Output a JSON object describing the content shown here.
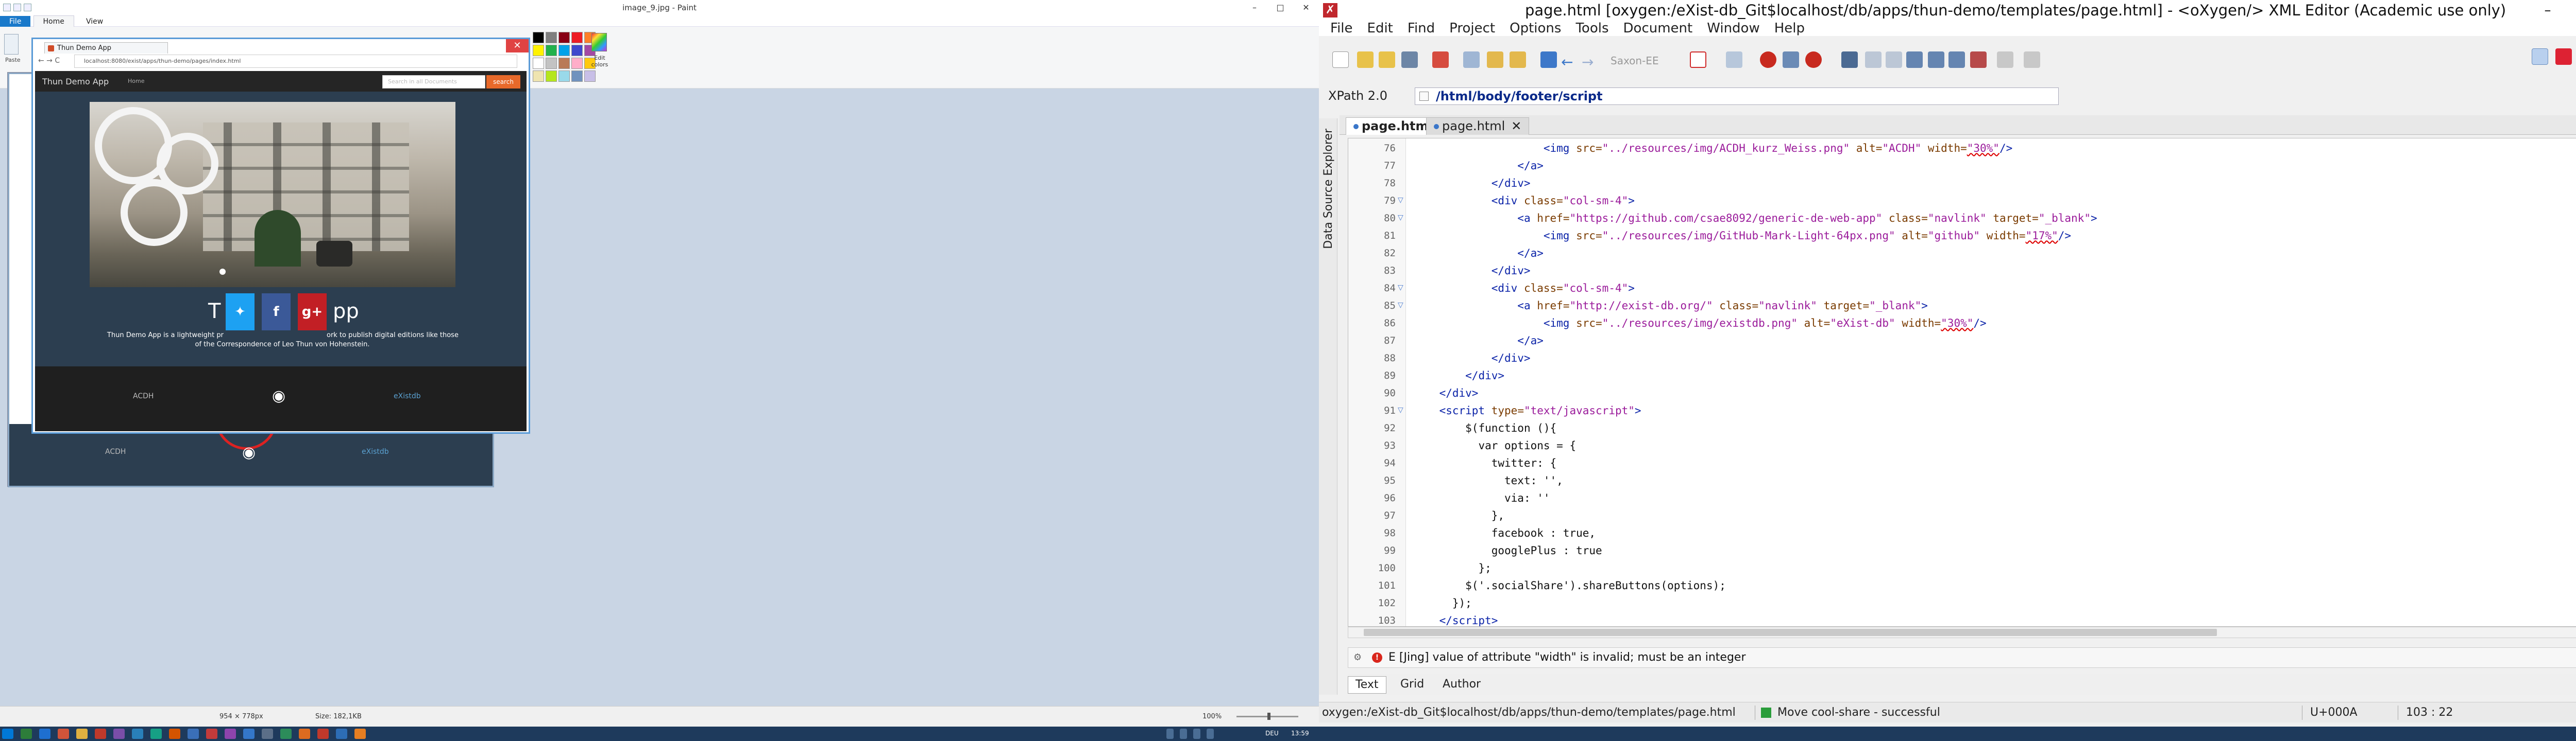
{
  "paint": {
    "title": "image_9.jpg - Paint",
    "tabs": [
      "File",
      "Home",
      "View"
    ],
    "paste_label": "Paste",
    "edit_colors": "Edit colors",
    "palette": [
      "#000000",
      "#7f7f7f",
      "#880015",
      "#ed1c24",
      "#ff7f27",
      "#fff200",
      "#22b14c",
      "#00a2e8",
      "#3f48cc",
      "#a349a4",
      "#ffffff",
      "#c3c3c3",
      "#b97a57",
      "#ffaec9",
      "#ffc90e",
      "#efe4b0",
      "#b5e61d",
      "#99d9ea",
      "#7092be",
      "#c8bfe7"
    ],
    "status": {
      "dimensions": "954 × 778px",
      "size": "Size: 182,1KB",
      "zoom": "100%"
    }
  },
  "browser": {
    "tab_title": "Thun Demo App",
    "address": "localhost:8080/exist/apps/thun-demo/pages/index.html",
    "site": {
      "brand": "Thun Demo App",
      "nav_home": "Home",
      "search_placeholder": "Search in all Documents",
      "search_button": "search",
      "heading": "Thun Demo App",
      "heading_visible": "pp",
      "heading_partial": "T",
      "description": "Thun Demo App is a lightweight project to publish digital editions like those of the Correspondence of Leo Thun von Hohenstein.",
      "desc_line1": "Thun Demo App is a lightweight pr",
      "desc_line1b": "ork to publish digital editions like those",
      "desc_line2": "of the Correspondence of Leo Thun von Hohenstein.",
      "share": [
        "twitter",
        "f",
        "g+"
      ],
      "footer": [
        "ACDH",
        "github",
        "eXistdb"
      ]
    }
  },
  "oxygen": {
    "title": "page.html [oxygen:/eXist-db_Git$localhost/db/apps/thun-demo/templates/page.html] - <oXygen/> XML Editor (Academic use only)",
    "menu": [
      "File",
      "Edit",
      "Find",
      "Project",
      "Options",
      "Tools",
      "Document",
      "Window",
      "Help"
    ],
    "saxon": "Saxon-EE",
    "xpath_label": "XPath 2.0",
    "xpath_value": "/html/body/footer/script",
    "side_panel": "Data Source Explorer",
    "tabs": [
      "page.html",
      "page.html"
    ],
    "lines": [
      {
        "n": "76",
        "html": "                    <span class='tg'>&lt;img</span> <span class='at'>src=</span><span class='vl'>\"../resources/img/ACDH_kurz_Weiss.png\"</span> <span class='at'>alt=</span><span class='vl'>\"ACDH\"</span> <span class='at'>width=</span><span class='vl err'>\"30%\"</span><span class='tg'>/&gt;</span>"
      },
      {
        "n": "77",
        "html": "                <span class='tg'>&lt;/a&gt;</span>"
      },
      {
        "n": "78",
        "html": "            <span class='tg'>&lt;/div&gt;</span>"
      },
      {
        "n": "79",
        "fold": true,
        "html": "            <span class='tg'>&lt;div</span> <span class='at'>class=</span><span class='vl'>\"col-sm-4\"</span><span class='tg'>&gt;</span>"
      },
      {
        "n": "80",
        "fold": true,
        "html": "                <span class='tg'>&lt;a</span> <span class='at'>href=</span><span class='vl'>\"https://github.com/csae8092/generic-de-web-app\"</span> <span class='at'>class=</span><span class='vl'>\"navlink\"</span> <span class='at'>target=</span><span class='vl'>\"_blank\"</span><span class='tg'>&gt;</span>"
      },
      {
        "n": "81",
        "html": "                    <span class='tg'>&lt;img</span> <span class='at'>src=</span><span class='vl'>\"../resources/img/GitHub-Mark-Light-64px.png\"</span> <span class='at'>alt=</span><span class='vl'>\"github\"</span> <span class='at'>width=</span><span class='vl err'>\"17%\"</span><span class='tg'>/&gt;</span>"
      },
      {
        "n": "82",
        "html": "                <span class='tg'>&lt;/a&gt;</span>"
      },
      {
        "n": "83",
        "html": "            <span class='tg'>&lt;/div&gt;</span>"
      },
      {
        "n": "84",
        "fold": true,
        "html": "            <span class='tg'>&lt;div</span> <span class='at'>class=</span><span class='vl'>\"col-sm-4\"</span><span class='tg'>&gt;</span>"
      },
      {
        "n": "85",
        "fold": true,
        "html": "                <span class='tg'>&lt;a</span> <span class='at'>href=</span><span class='vl'>\"http://exist-db.org/\"</span> <span class='at'>class=</span><span class='vl'>\"navlink\"</span> <span class='at'>target=</span><span class='vl'>\"_blank\"</span><span class='tg'>&gt;</span>"
      },
      {
        "n": "86",
        "html": "                    <span class='tg'>&lt;img</span> <span class='at'>src=</span><span class='vl'>\"../resources/img/existdb.png\"</span> <span class='at'>alt=</span><span class='vl'>\"eXist-db\"</span> <span class='at'>width=</span><span class='vl err'>\"30%\"</span><span class='tg'>/&gt;</span>"
      },
      {
        "n": "87",
        "html": "                <span class='tg'>&lt;/a&gt;</span>"
      },
      {
        "n": "88",
        "html": "            <span class='tg'>&lt;/div&gt;</span>"
      },
      {
        "n": "89",
        "html": "        <span class='tg'>&lt;/div&gt;</span>"
      },
      {
        "n": "90",
        "html": "    <span class='tg'>&lt;/div&gt;</span>"
      },
      {
        "n": "91",
        "fold": true,
        "html": "    <span class='tg'>&lt;script</span> <span class='at'>type=</span><span class='vl'>\"text/javascript\"</span><span class='tg'>&gt;</span>"
      },
      {
        "n": "92",
        "html": "        <span class='tx'>$(function (){</span>"
      },
      {
        "n": "93",
        "html": "          <span class='tx'>var options = {</span>"
      },
      {
        "n": "94",
        "html": "            <span class='tx'>twitter: {</span>"
      },
      {
        "n": "95",
        "html": "              <span class='tx'>text: '',</span>"
      },
      {
        "n": "96",
        "html": "              <span class='tx'>via: ''</span>"
      },
      {
        "n": "97",
        "html": "            <span class='tx'>},</span>"
      },
      {
        "n": "98",
        "html": "            <span class='tx'>facebook : true,</span>"
      },
      {
        "n": "99",
        "html": "            <span class='tx'>googlePlus : true</span>"
      },
      {
        "n": "100",
        "html": "          <span class='tx'>};</span>"
      },
      {
        "n": "101",
        "html": "        <span class='tx'>$('.socialShare').shareButtons(options);</span>"
      },
      {
        "n": "102",
        "html": "      <span class='tx'>});</span>"
      },
      {
        "n": "103",
        "html": "    <span class='tg'>&lt;/script&gt;</span>"
      }
    ],
    "message": "E [Jing] value of attribute \"width\" is invalid; must be an integer",
    "modes": [
      "Text",
      "Grid",
      "Author"
    ],
    "status": {
      "path": "oxygen:/eXist-db_Git$localhost/db/apps/thun-demo/templates/page.html",
      "message": "Move cool-share - successful",
      "unicode": "U+000A",
      "position": "103 : 22"
    }
  },
  "taskbar": {
    "language": "DEU",
    "time": "13:59"
  }
}
